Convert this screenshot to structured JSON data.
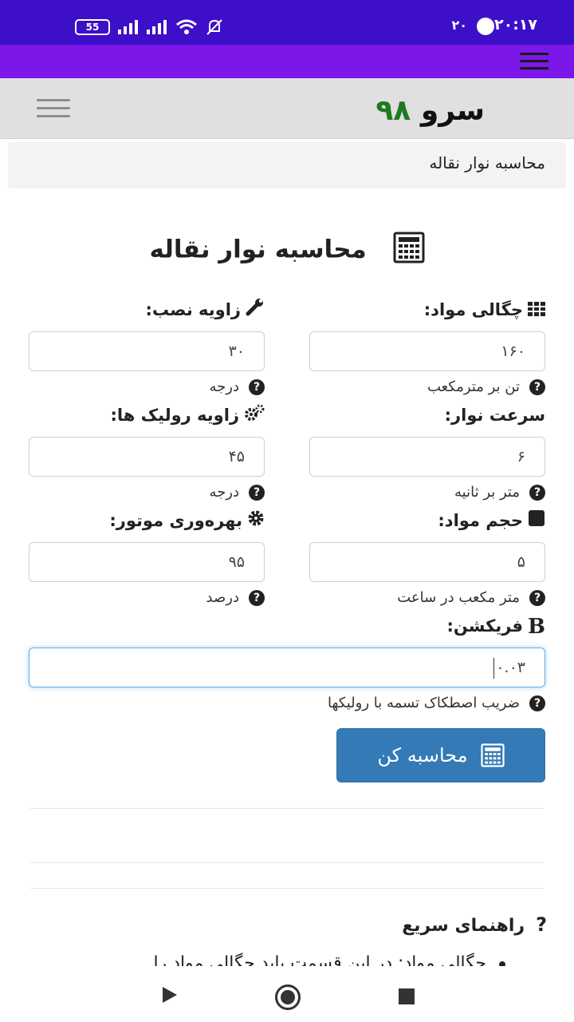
{
  "status_bar": {
    "time": "۲۰:۱۷",
    "notification_count": "۲۰",
    "battery": "55"
  },
  "brand": {
    "part1": "سرو",
    "part2": "۹۸"
  },
  "breadcrumb": "محاسبه نوار نقاله",
  "page_title": "محاسبه نوار نقاله",
  "fields": {
    "density": {
      "label": "چگالی مواد:",
      "value": "۱۶۰",
      "hint": "تن بر مترمکعب",
      "icon": "grid-icon"
    },
    "install_angle": {
      "label": "زاویه نصب:",
      "value": "۳۰",
      "hint": "درجه",
      "icon": "wrench-icon"
    },
    "belt_speed": {
      "label": "سرعت نوار:",
      "value": "۶",
      "hint": "متر بر ثانیه"
    },
    "roller_angle": {
      "label": "زاویه رولیک ها:",
      "value": "۴۵",
      "hint": "درجه",
      "icon": "gears-icon"
    },
    "volume": {
      "label": "حجم مواد:",
      "value": "۵",
      "hint": "متر مکعب در ساعت",
      "icon": "cube-icon"
    },
    "motor_efficiency": {
      "label": "بهره‌وری موتور:",
      "value": "۹۵",
      "hint": "درصد",
      "icon": "gear-icon"
    },
    "friction": {
      "label": "فریکشن:",
      "label_icon_text": "B",
      "value": "۰.۰۳",
      "hint": "ضریب اصطکاک تسمه با رولیکها"
    }
  },
  "calculate_button": "محاسبه کن",
  "guide": {
    "title": "راهنمای سریع",
    "title_icon": "?",
    "first_item": "چگالی مواد: در این قسمت باید چگالی مواد را"
  },
  "colors": {
    "status_bar": "#3d0fc9",
    "app_bar": "#7b17e8",
    "brand_number": "#1e7a1e",
    "button": "#337ab7"
  }
}
